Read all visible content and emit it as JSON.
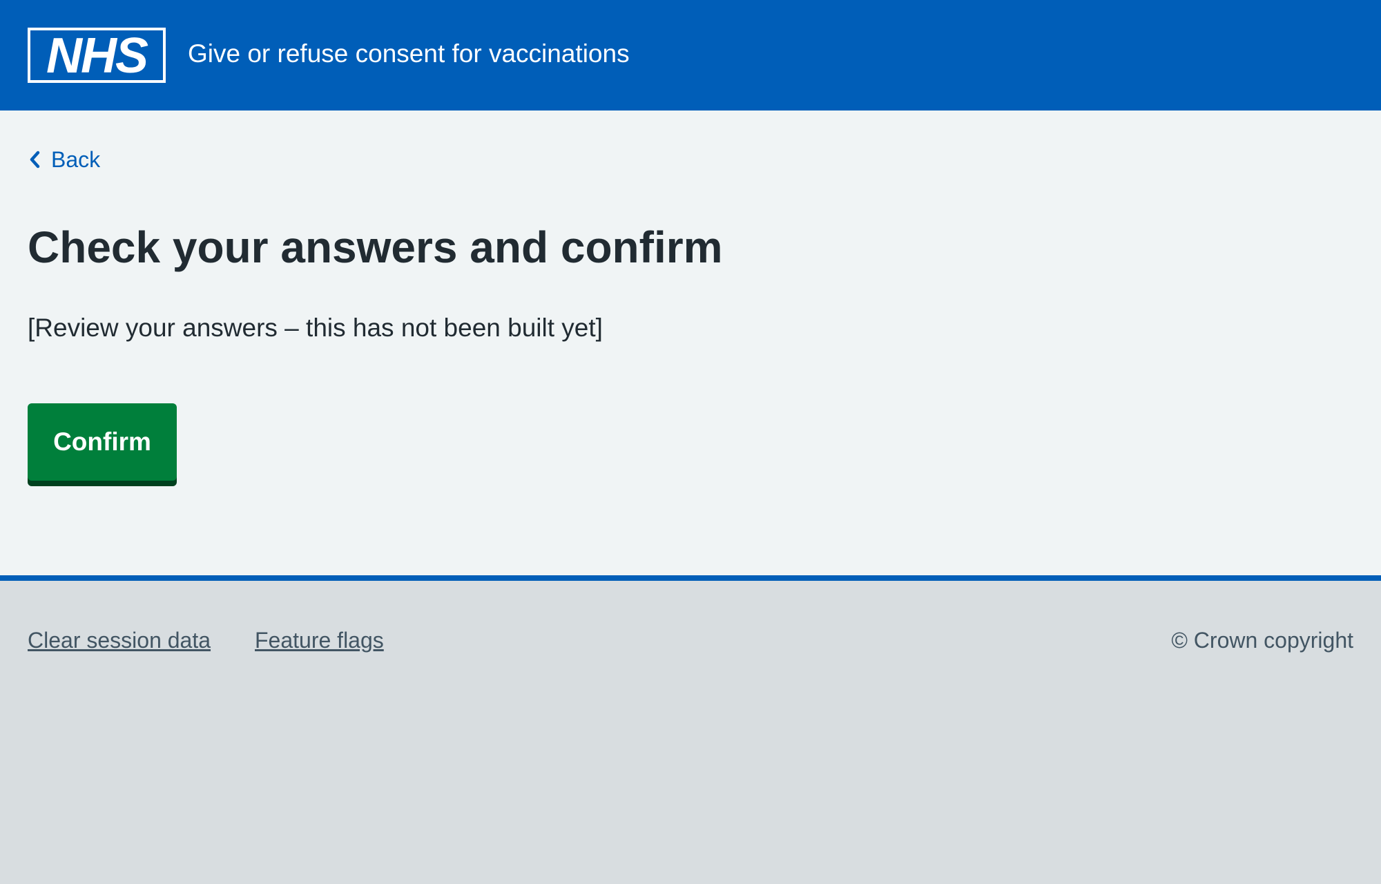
{
  "header": {
    "logo_text": "NHS",
    "service_name": "Give or refuse consent for vaccinations"
  },
  "main": {
    "back_label": "Back",
    "title": "Check your answers and confirm",
    "lead": "[Review your answers – this has not been built yet]",
    "confirm_label": "Confirm"
  },
  "footer": {
    "links": [
      {
        "label": "Clear session data"
      },
      {
        "label": "Feature flags"
      }
    ],
    "copyright": "© Crown copyright"
  },
  "colors": {
    "header_blue": "#005eb8",
    "page_background": "#f0f4f5",
    "footer_background": "#d8dde0",
    "button_green": "#007f3b",
    "button_shadow": "#00401e",
    "text_primary": "#212b32",
    "text_secondary": "#425563"
  },
  "icons": {
    "back": "chevron-left-icon",
    "logo": "nhs-logo"
  }
}
